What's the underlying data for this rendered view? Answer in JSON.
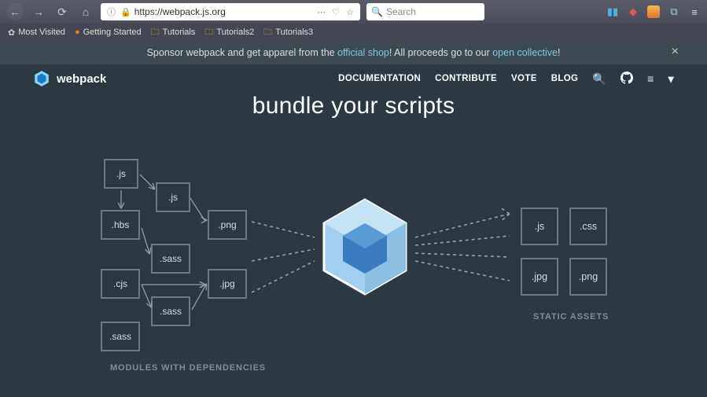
{
  "browser": {
    "url": "https://webpack.js.org",
    "search_placeholder": "Search",
    "bookmarks": [
      "Most Visited",
      "Getting Started",
      "Tutorials",
      "Tutorials2",
      "Tutorials3"
    ]
  },
  "banner": {
    "prefix": "Sponsor webpack and get apparel from the ",
    "link1": "official shop",
    "middle": "! All proceeds go to our ",
    "link2": "open collective",
    "suffix": "!"
  },
  "header": {
    "brand": "webpack",
    "nav": {
      "docs": "DOCUMENTATION",
      "contribute": "CONTRIBUTE",
      "vote": "VOTE",
      "blog": "BLOG"
    }
  },
  "hero": "bundle your scripts",
  "modules": {
    "js1": ".js",
    "js2": ".js",
    "hbs": ".hbs",
    "png": ".png",
    "sass1": ".sass",
    "cjs": ".cjs",
    "jpg": ".jpg",
    "sass2": ".sass",
    "sass3": ".sass"
  },
  "outputs": {
    "js": ".js",
    "css": ".css",
    "jpg": ".jpg",
    "png": ".png"
  },
  "captions": {
    "left": "MODULES WITH DEPENDENCIES",
    "right": "STATIC ASSETS"
  }
}
